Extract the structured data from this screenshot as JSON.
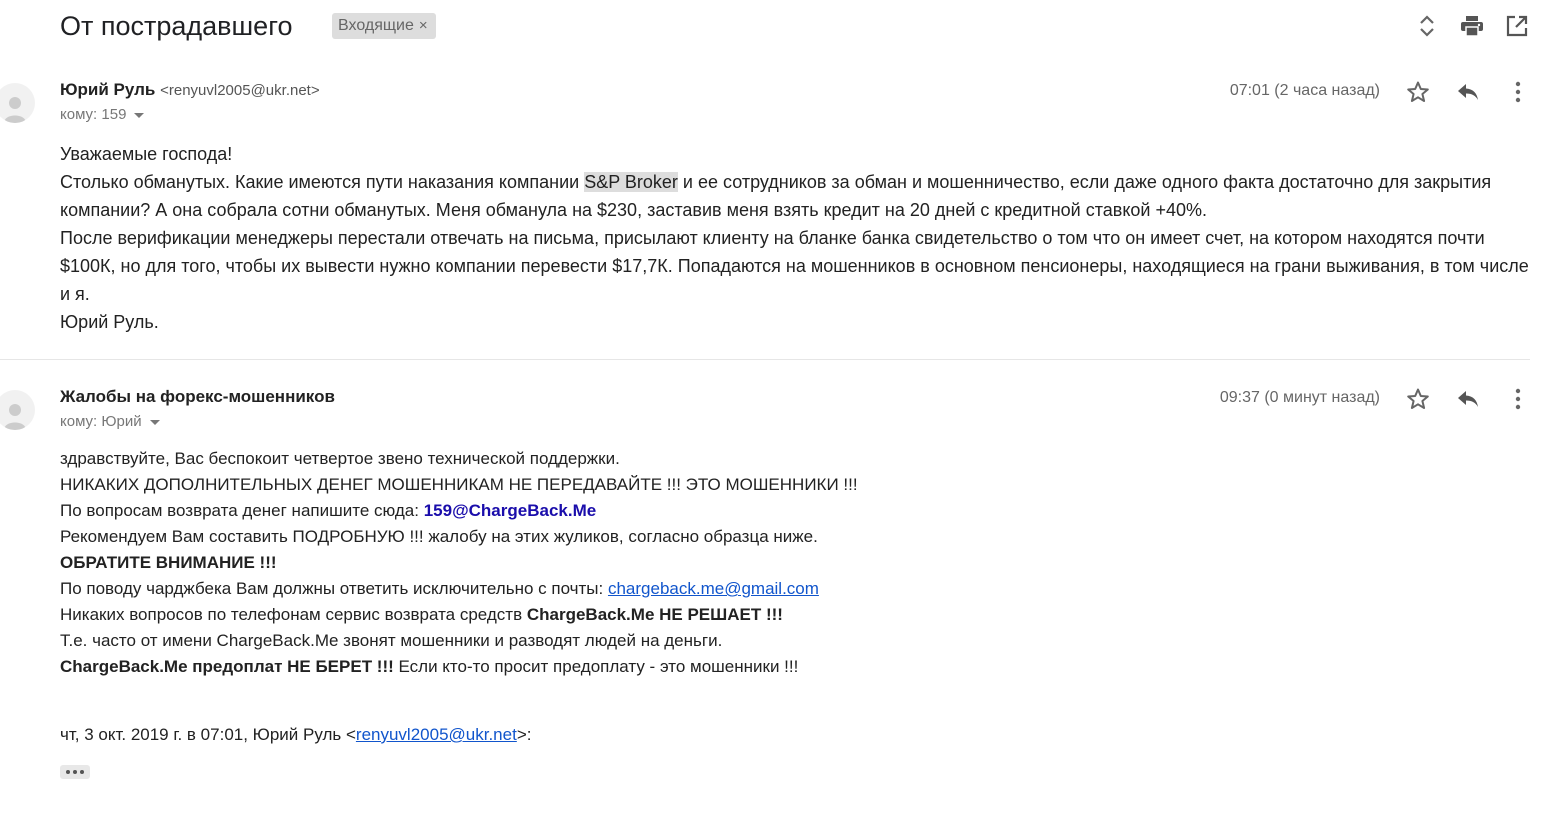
{
  "thread": {
    "subject": "От пострадавшего",
    "label": "Входящие",
    "label_remove": "×"
  },
  "icons": {
    "expand": "unfold-icon",
    "print": "print-icon",
    "popout": "open-in-new-icon",
    "star": "star-icon",
    "reply": "reply-icon",
    "more": "more-vert-icon",
    "avatar": "person-icon"
  },
  "messages": [
    {
      "sender_name": "Юрий Руль",
      "sender_email": "<renyuvl2005@ukr.net>",
      "to_line": "кому: 159",
      "time": "07:01 (2 часа назад)",
      "body": {
        "line1": "Уважаемые господа!",
        "p2_before": "Столько обманутых. Какие имеются пути наказания компании ",
        "p2_highlight": "S&P Broker",
        "p2_after": " и ее сотрудников за обман и мошенничество, если даже одного факта достаточно для закрытия компании? А она собрала сотни обманутых. Меня обманула на $230, заставив меня взять кредит на 20 дней с кредитной ставкой +40%.",
        "p3": "После верификации менеджеры перестали отвечать на письма, присылают клиенту на бланке банка свидетельство о том что он имеет счет, на котором находятся почти $100К, но для того, чтобы их вывести нужно компании перевести $17,7К. Попадаются на мошенников в основном пенсионеры, находящиеся на грани выживания, в том числе и я.",
        "signature": "Юрий Руль."
      }
    },
    {
      "sender_name": "Жалобы на форекс-мошенников",
      "to_line": "кому: Юрий",
      "time": "09:37 (0 минут назад)",
      "body": {
        "l1": "здравствуйте, Вас беспокоит четвертое звено технической поддержки.",
        "l2": "НИКАКИХ ДОПОЛНИТЕЛЬНЫХ ДЕНЕГ МОШЕННИКАМ НЕ ПЕРЕДАВАЙТЕ !!! ЭТО МОШЕННИКИ !!!",
        "l3_text": "По вопросам возврата денег напишите сюда: ",
        "l3_link": "159@ChargeBack.Me",
        "l4": "Рекомендуем Вам составить ПОДРОБНУЮ !!! жалобу на этих жуликов, согласно образца ниже.",
        "l5": "ОБРАТИТЕ ВНИМАНИЕ !!!",
        "l6_text": "По поводу чарджбека Вам должны ответить исключительно с почты: ",
        "l6_link": "chargeback.me@gmail.com",
        "l7_text": "Никаких вопросов по телефонам сервис возврата средств ",
        "l7_bold": "ChargeBack.Me НЕ РЕШАЕТ !!!",
        "l8": "Т.е. часто от имени ChargeBack.Me звонят мошенники и разводят людей на деньги.",
        "l9_bold": "ChargeBack.Me предоплат НЕ БЕРЕТ !!!",
        "l9_text": " Если кто-то просит предоплату - это мошенники !!!"
      },
      "quote": {
        "prefix": "чт, 3 окт. 2019 г. в 07:01, Юрий Руль <",
        "link": "renyuvl2005@ukr.net",
        "suffix": ">:"
      },
      "show_trimmed": "•••"
    }
  ]
}
